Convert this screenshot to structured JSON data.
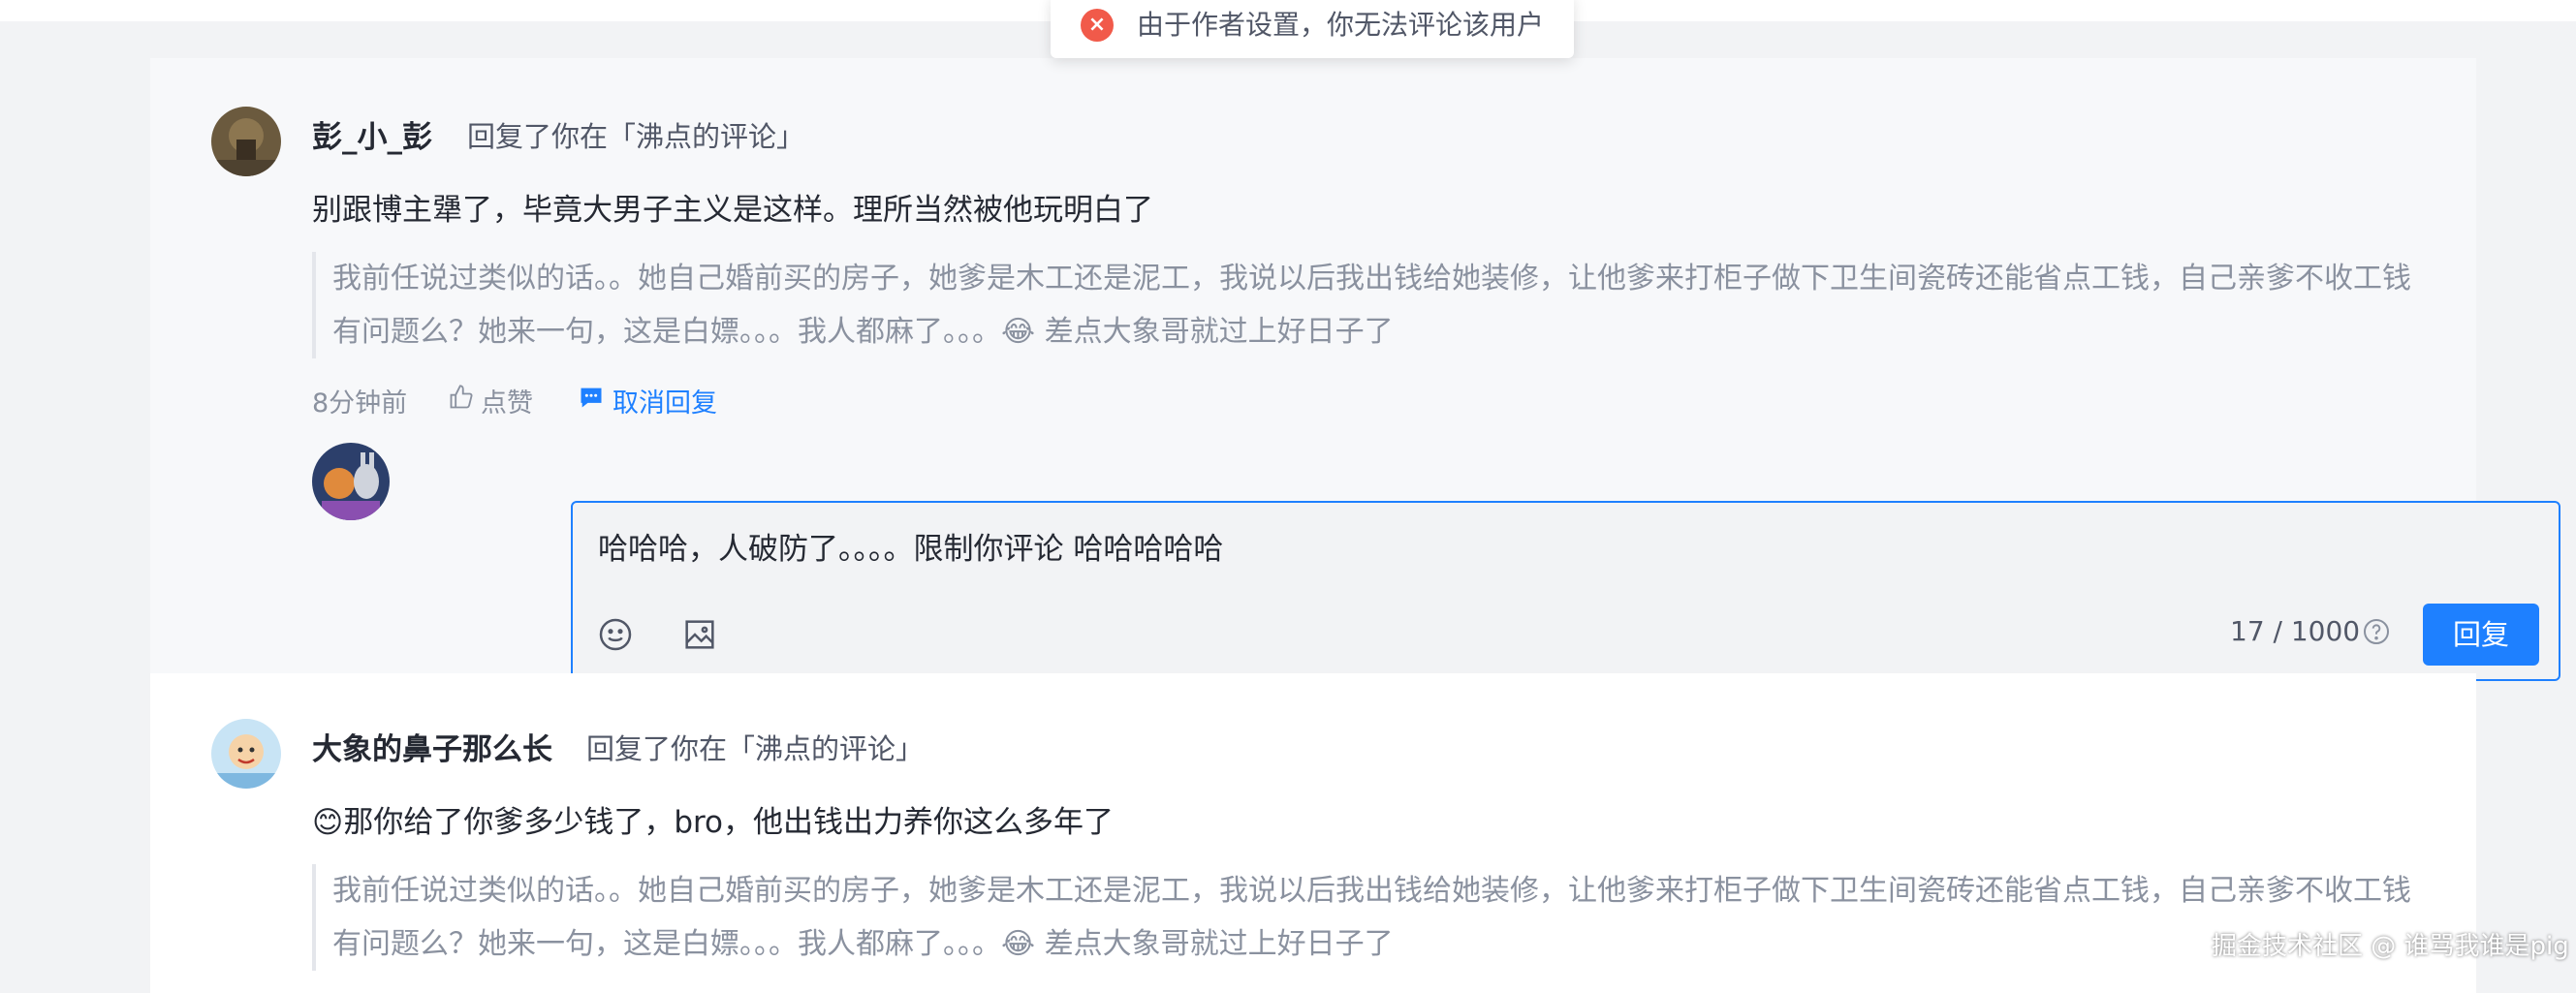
{
  "toast": {
    "icon": "close-circle-icon",
    "text": "由于作者设置，你无法评论该用户"
  },
  "comments": [
    {
      "username": "彭_小_彭",
      "action": "回复了你在「沸点的评论」",
      "content": "别跟博主犟了，毕竟大男子主义是这样。理所当然被他玩明白了",
      "quote": "我前任说过类似的话。。她自己婚前买的房子，她爹是木工还是泥工，我说以后我出钱给她装修，让他爹来打柜子做下卫生间瓷砖还能省点工钱，自己亲爹不收工钱有问题么？她来一句，这是白嫖。。。我人都麻了。。。😂 差点大象哥就过上好日子了",
      "time": "8分钟前",
      "like_label": "点赞",
      "reply_label": "取消回复"
    },
    {
      "username": "大象的鼻子那么长",
      "action": "回复了你在「沸点的评论」",
      "content": "😊那你给了你爹多少钱了，bro，他出钱出力养你这么多年了",
      "quote": "我前任说过类似的话。。她自己婚前买的房子，她爹是木工还是泥工，我说以后我出钱给她装修，让他爹来打柜子做下卫生间瓷砖还能省点工钱，自己亲爹不收工钱有问题么？她来一句，这是白嫖。。。我人都麻了。。。😂 差点大象哥就过上好日子了"
    }
  ],
  "editor": {
    "value": "哈哈哈，人破防了。。。。限制你评论 哈哈哈哈哈",
    "count": "17 / 1000",
    "submit_label": "回复"
  },
  "watermark": "掘金技术社区 @ 谁骂我谁是pig",
  "colors": {
    "accent": "#1e80ff",
    "error": "#f15a4a",
    "text": "#252933",
    "muted": "#8a919f"
  }
}
